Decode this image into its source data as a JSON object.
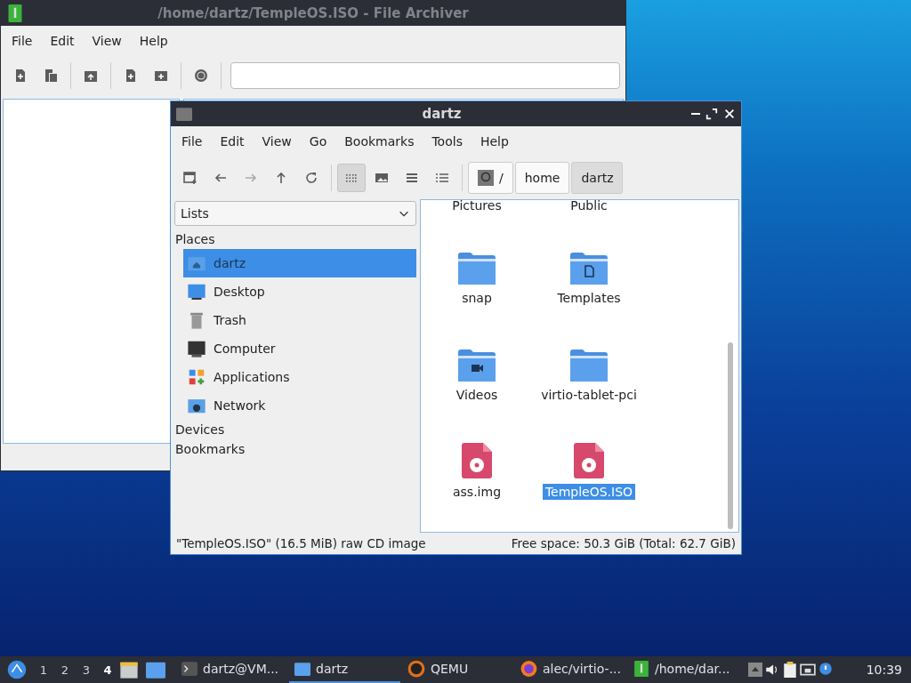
{
  "archiver": {
    "title": "/home/dartz/TempleOS.ISO - File Archiver",
    "menu": [
      "File",
      "Edit",
      "View",
      "Help"
    ]
  },
  "file_manager": {
    "title": "dartz",
    "menu": [
      "File",
      "Edit",
      "View",
      "Go",
      "Bookmarks",
      "Tools",
      "Help"
    ],
    "view_modes": [
      {
        "kind": "icons",
        "selected": true
      },
      {
        "kind": "thumbnails",
        "selected": false
      },
      {
        "kind": "compact",
        "selected": false
      },
      {
        "kind": "details",
        "selected": false
      }
    ],
    "path": [
      {
        "label": "/",
        "kind": "root",
        "selected": false
      },
      {
        "label": "home",
        "kind": "dir",
        "selected": false
      },
      {
        "label": "dartz",
        "kind": "dir",
        "selected": true
      }
    ],
    "side_pane": {
      "dropdown": "Lists",
      "sections": [
        {
          "title": "Places",
          "items": [
            {
              "label": "dartz",
              "kind": "home",
              "selected": true
            },
            {
              "label": "Desktop",
              "kind": "desktop",
              "selected": false
            },
            {
              "label": "Trash",
              "kind": "trash",
              "selected": false
            },
            {
              "label": "Computer",
              "kind": "computer",
              "selected": false
            },
            {
              "label": "Applications",
              "kind": "apps",
              "selected": false
            },
            {
              "label": "Network",
              "kind": "network",
              "selected": false
            }
          ]
        },
        {
          "title": "Devices"
        },
        {
          "title": "Bookmarks"
        }
      ]
    },
    "files": [
      {
        "name": "Pictures",
        "kind": "scrolled"
      },
      {
        "name": "Public",
        "kind": "scrolled"
      },
      {
        "name": "snap",
        "kind": "folder",
        "selected": false
      },
      {
        "name": "Templates",
        "kind": "templates",
        "selected": false
      },
      {
        "name": "Videos",
        "kind": "videos",
        "selected": false
      },
      {
        "name": "virtio-tablet-pci",
        "kind": "folder",
        "selected": false
      },
      {
        "name": "ass.img",
        "kind": "disc",
        "selected": false
      },
      {
        "name": "TempleOS.ISO",
        "kind": "disc",
        "selected": true
      }
    ],
    "status": {
      "left": "\"TempleOS.ISO\" (16.5 MiB) raw CD image",
      "right": "Free space: 50.3 GiB (Total: 62.7 GiB)"
    }
  },
  "taskbar": {
    "workspaces": [
      {
        "label": "1",
        "selected": false
      },
      {
        "label": "2",
        "selected": false
      },
      {
        "label": "3",
        "selected": false
      },
      {
        "label": "4",
        "selected": true
      }
    ],
    "tasks": [
      {
        "label": "dartz@VM...",
        "kind": "terminal",
        "selected": false
      },
      {
        "label": "dartz",
        "kind": "folder",
        "selected": true
      },
      {
        "label": "QEMU",
        "kind": "qemu",
        "selected": false
      },
      {
        "label": "alec/virtio-...",
        "kind": "browser",
        "selected": false
      },
      {
        "label": "/home/dar...",
        "kind": "archive",
        "selected": false
      }
    ],
    "clock": "10:39"
  }
}
